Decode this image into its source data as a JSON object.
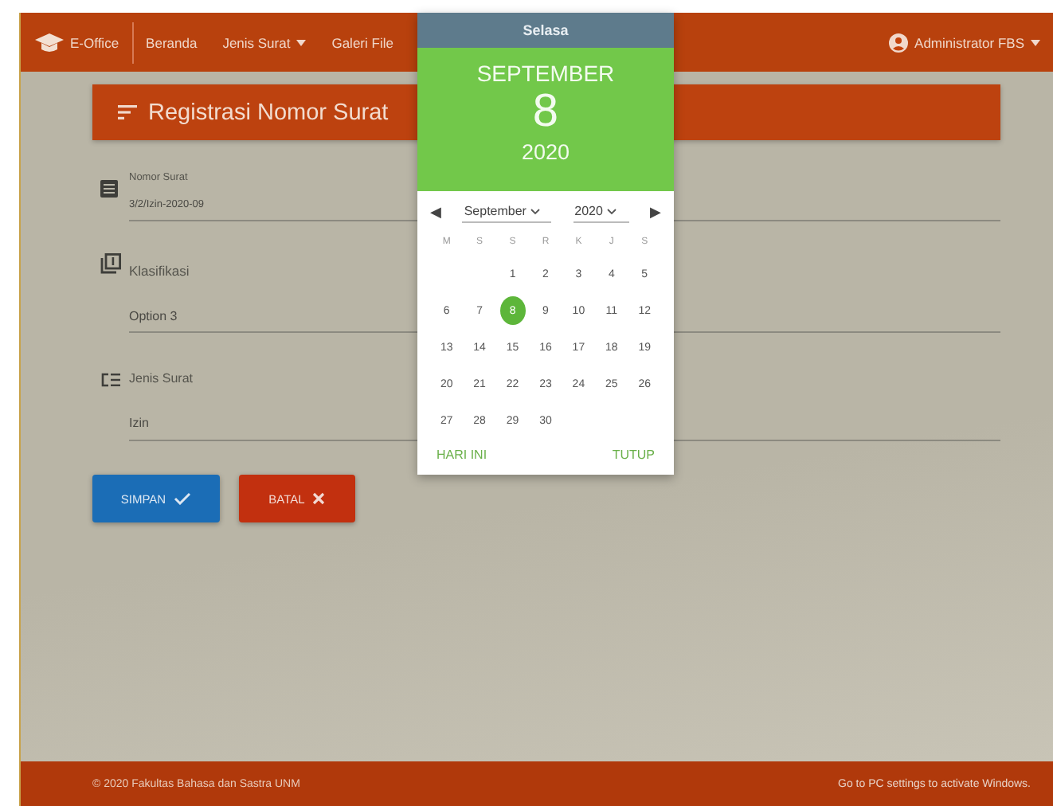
{
  "navbar": {
    "brand": "E-Office",
    "links": [
      {
        "label": "Beranda",
        "dropdown": false
      },
      {
        "label": "Jenis Surat",
        "dropdown": true
      },
      {
        "label": "Galeri File",
        "dropdown": false
      }
    ],
    "user": "Administrator FBS"
  },
  "card": {
    "title": "Registrasi Nomor Surat"
  },
  "fields": [
    {
      "kind": "document",
      "label": "Nomor Surat",
      "value": "3/2/Izin-2020-09"
    },
    {
      "kind": "stack",
      "label": "Klasifikasi",
      "value": "Option 3"
    },
    {
      "kind": "list",
      "label": "Jenis Surat",
      "value": "Izin"
    }
  ],
  "buttons": [
    {
      "kind": "save",
      "label": "SIMPAN"
    },
    {
      "kind": "cancel",
      "label": "BATAL"
    }
  ],
  "datepicker": {
    "weekday": "Selasa",
    "month": "SEPTEMBER",
    "day": "8",
    "year": "2020",
    "prev": "◀",
    "next": "▶",
    "month_select": "September",
    "year_select": "2020",
    "weekdays": [
      "M",
      "S",
      "S",
      "R",
      "K",
      "J",
      "S"
    ],
    "weeks": [
      [
        {
          "label": "1",
          "selected": false
        },
        {
          "label": "2",
          "selected": false
        },
        {
          "label": "3",
          "selected": false
        },
        {
          "label": "4",
          "selected": false
        },
        {
          "label": "5",
          "selected": false
        }
      ],
      [
        {
          "label": "6",
          "selected": false
        },
        {
          "label": "7",
          "selected": false
        },
        {
          "label": "8",
          "selected": true
        },
        {
          "label": "9",
          "selected": false
        },
        {
          "label": "10",
          "selected": false
        },
        {
          "label": "11",
          "selected": false
        },
        {
          "label": "12",
          "selected": false
        }
      ],
      [
        {
          "label": "13",
          "selected": false
        },
        {
          "label": "14",
          "selected": false
        },
        {
          "label": "15",
          "selected": false
        },
        {
          "label": "16",
          "selected": false
        },
        {
          "label": "17",
          "selected": false
        },
        {
          "label": "18",
          "selected": false
        },
        {
          "label": "19",
          "selected": false
        }
      ],
      [
        {
          "label": "20",
          "selected": false
        },
        {
          "label": "21",
          "selected": false
        },
        {
          "label": "22",
          "selected": false
        },
        {
          "label": "23",
          "selected": false
        },
        {
          "label": "24",
          "selected": false
        },
        {
          "label": "25",
          "selected": false
        },
        {
          "label": "26",
          "selected": false
        }
      ],
      [
        {
          "label": "27",
          "selected": false
        },
        {
          "label": "28",
          "selected": false
        },
        {
          "label": "29",
          "selected": false
        },
        {
          "label": "30",
          "selected": false
        }
      ]
    ],
    "today": "HARI INI",
    "close": "TUTUP"
  },
  "footer": "© 2020 Fakultas Bahasa dan Sastra UNM",
  "os_notice": "Go to PC settings to activate Windows."
}
